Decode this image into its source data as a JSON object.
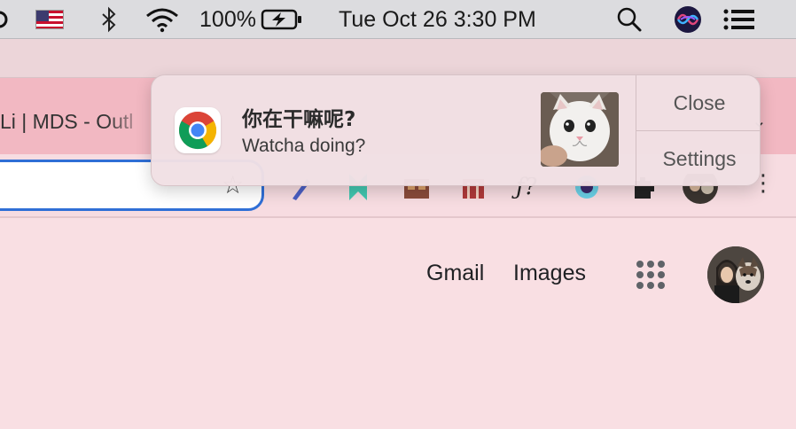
{
  "menubar": {
    "battery_percent": "100%",
    "datetime": "Tue Oct 26  3:30 PM",
    "icons": [
      "app-icon",
      "us-flag-icon",
      "bluetooth-icon",
      "wifi-icon",
      "battery-charging-icon",
      "spotlight-search-icon",
      "siri-icon",
      "control-center-icon"
    ]
  },
  "browser": {
    "tab_title": "Li | MDS - Outl"
  },
  "page": {
    "gmail_label": "Gmail",
    "images_label": "Images"
  },
  "notification": {
    "title": "你在干嘛呢?",
    "body": "Watcha doing?",
    "close_label": "Close",
    "settings_label": "Settings"
  },
  "colors": {
    "page_bg": "#f9dfe3",
    "tabstrip_bg": "#f2b8c2",
    "omnibox_focus": "#2f6fd6",
    "menubar_bg": "#dcdcdf"
  }
}
